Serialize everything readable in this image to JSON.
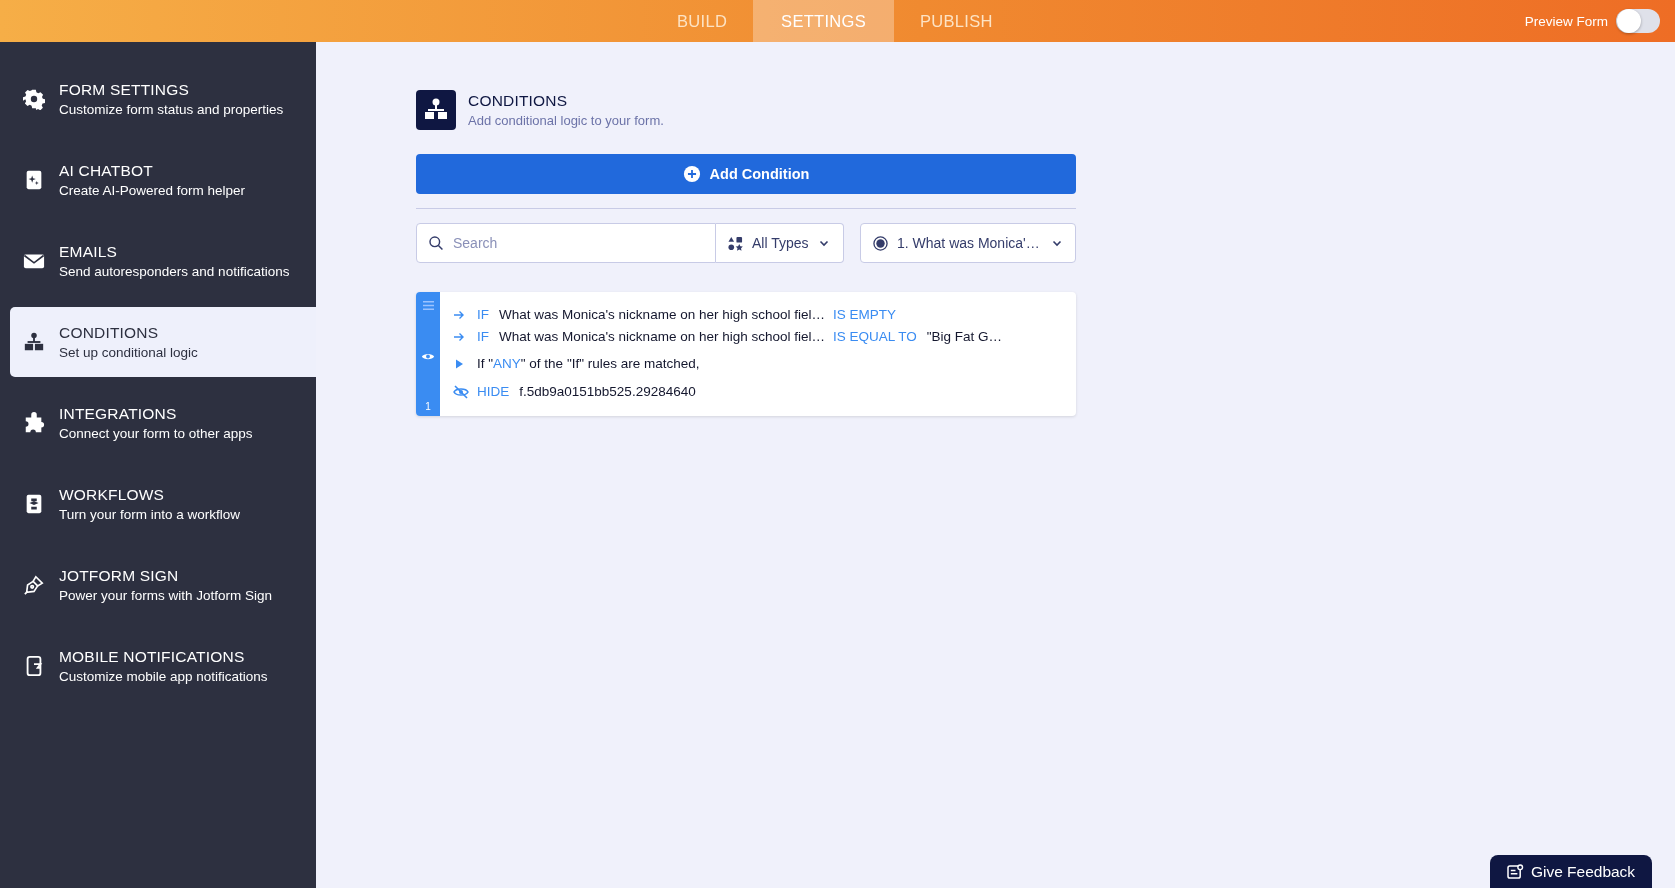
{
  "top_bar": {
    "tabs": [
      {
        "label": "BUILD",
        "selected": false
      },
      {
        "label": "SETTINGS",
        "selected": true
      },
      {
        "label": "PUBLISH",
        "selected": false
      }
    ],
    "preview": {
      "label": "Preview Form",
      "on": false
    }
  },
  "sidebar": {
    "items": [
      {
        "title": "FORM SETTINGS",
        "subtitle": "Customize form status and properties",
        "selected": false
      },
      {
        "title": "AI CHATBOT",
        "subtitle": "Create AI-Powered form helper",
        "selected": false
      },
      {
        "title": "EMAILS",
        "subtitle": "Send autoresponders and notifications",
        "selected": false
      },
      {
        "title": "CONDITIONS",
        "subtitle": "Set up conditional logic",
        "selected": true
      },
      {
        "title": "INTEGRATIONS",
        "subtitle": "Connect your form to other apps",
        "selected": false
      },
      {
        "title": "WORKFLOWS",
        "subtitle": "Turn your form into a workflow",
        "selected": false
      },
      {
        "title": "JOTFORM SIGN",
        "subtitle": "Power your forms with Jotform Sign",
        "selected": false
      },
      {
        "title": "MOBILE NOTIFICATIONS",
        "subtitle": "Customize mobile app notifications",
        "selected": false
      }
    ]
  },
  "header": {
    "title": "CONDITIONS",
    "subtitle": "Add conditional logic to your form."
  },
  "add_button": "Add Condition",
  "filters": {
    "search": {
      "placeholder": "Search"
    },
    "type": "All Types",
    "field": "1. What was Monica'…"
  },
  "rules": [
    {
      "number": "1",
      "conditions": [
        {
          "keyword": "IF",
          "field": "What was Monica's nickname on her high school fiel…",
          "operator": "IS EMPTY"
        },
        {
          "keyword": "IF",
          "field": "What was Monica's nickname on her high school fiel…",
          "operator": "IS EQUAL TO",
          "value": "\"Big Fat G…"
        }
      ],
      "match": {
        "before": "If \"",
        "keyword": "ANY",
        "after": "\" of the \"If\" rules are matched,"
      },
      "action": {
        "verb": "HIDE",
        "target": "f.5db9a0151bb525.29284640"
      }
    }
  ],
  "feedback_button": "Give Feedback"
}
